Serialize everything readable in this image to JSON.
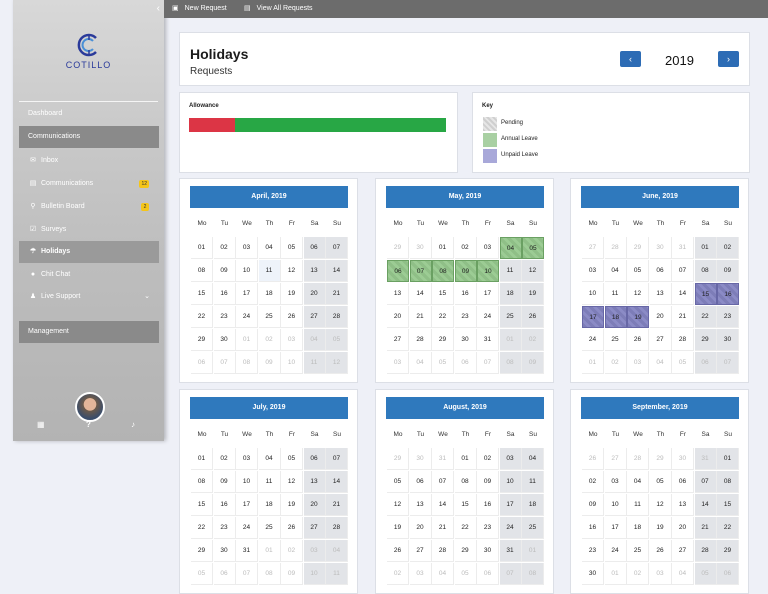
{
  "sidebar": {
    "brand": "COTILLO",
    "items": [
      {
        "label": "Dashboard",
        "icon": "",
        "badge": "",
        "style": "plain",
        "sub": false
      },
      {
        "label": "Communications",
        "icon": "",
        "badge": "",
        "style": "dark",
        "sub": false
      },
      {
        "label": "Inbox",
        "icon": "envelope-icon",
        "badge": "",
        "style": "plain",
        "sub": true
      },
      {
        "label": "Communications",
        "icon": "list-icon",
        "badge": "12",
        "style": "plain",
        "sub": true
      },
      {
        "label": "Bulletin Board",
        "icon": "pin-icon",
        "badge": "2",
        "style": "plain",
        "sub": true
      },
      {
        "label": "Surveys",
        "icon": "check-icon",
        "badge": "",
        "style": "plain",
        "sub": true
      },
      {
        "label": "Holidays",
        "icon": "umbrella-icon",
        "badge": "",
        "style": "active",
        "sub": true
      },
      {
        "label": "Chit Chat",
        "icon": "chat-icon",
        "badge": "",
        "style": "plain",
        "sub": true
      },
      {
        "label": "Live Support",
        "icon": "people-icon",
        "badge": "",
        "style": "plain",
        "sub": true,
        "chevron": true
      },
      {
        "label": "Management",
        "icon": "",
        "badge": "",
        "style": "dark",
        "sub": false
      }
    ],
    "footer_icons": [
      "grid-icon",
      "help-icon",
      "bell-icon"
    ]
  },
  "topbar": {
    "new_request": "New Request",
    "view_all": "View All Requests"
  },
  "page": {
    "title": "Holidays",
    "subtitle": "Requests",
    "year": "2019",
    "prev_label": "‹",
    "next_label": "›"
  },
  "allowance": {
    "label": "Allowance",
    "used_fraction": 0.18,
    "used_color": "#dc3545",
    "remaining_color": "#28a745"
  },
  "key": {
    "label": "Key",
    "items": [
      {
        "label": "Pending",
        "type": "pending"
      },
      {
        "label": "Annual Leave",
        "type": "annual"
      },
      {
        "label": "Unpaid Leave",
        "type": "unpaid"
      }
    ]
  },
  "weekdays": [
    "Mo",
    "Tu",
    "We",
    "Th",
    "Fr",
    "Sa",
    "Su"
  ],
  "months": [
    {
      "title": "April, 2019",
      "year": 2019,
      "month": 4,
      "annual": [],
      "unpaid": [],
      "today": 11
    },
    {
      "title": "May, 2019",
      "year": 2019,
      "month": 5,
      "annual": [
        4,
        5,
        6,
        7,
        8,
        9,
        10
      ],
      "unpaid": []
    },
    {
      "title": "June, 2019",
      "year": 2019,
      "month": 6,
      "annual": [],
      "unpaid": [
        15,
        16,
        17,
        18,
        19
      ]
    },
    {
      "title": "July, 2019",
      "year": 2019,
      "month": 7,
      "annual": [],
      "unpaid": []
    },
    {
      "title": "August, 2019",
      "year": 2019,
      "month": 8,
      "annual": [],
      "unpaid": []
    },
    {
      "title": "September, 2019",
      "year": 2019,
      "month": 9,
      "annual": [],
      "unpaid": []
    }
  ]
}
